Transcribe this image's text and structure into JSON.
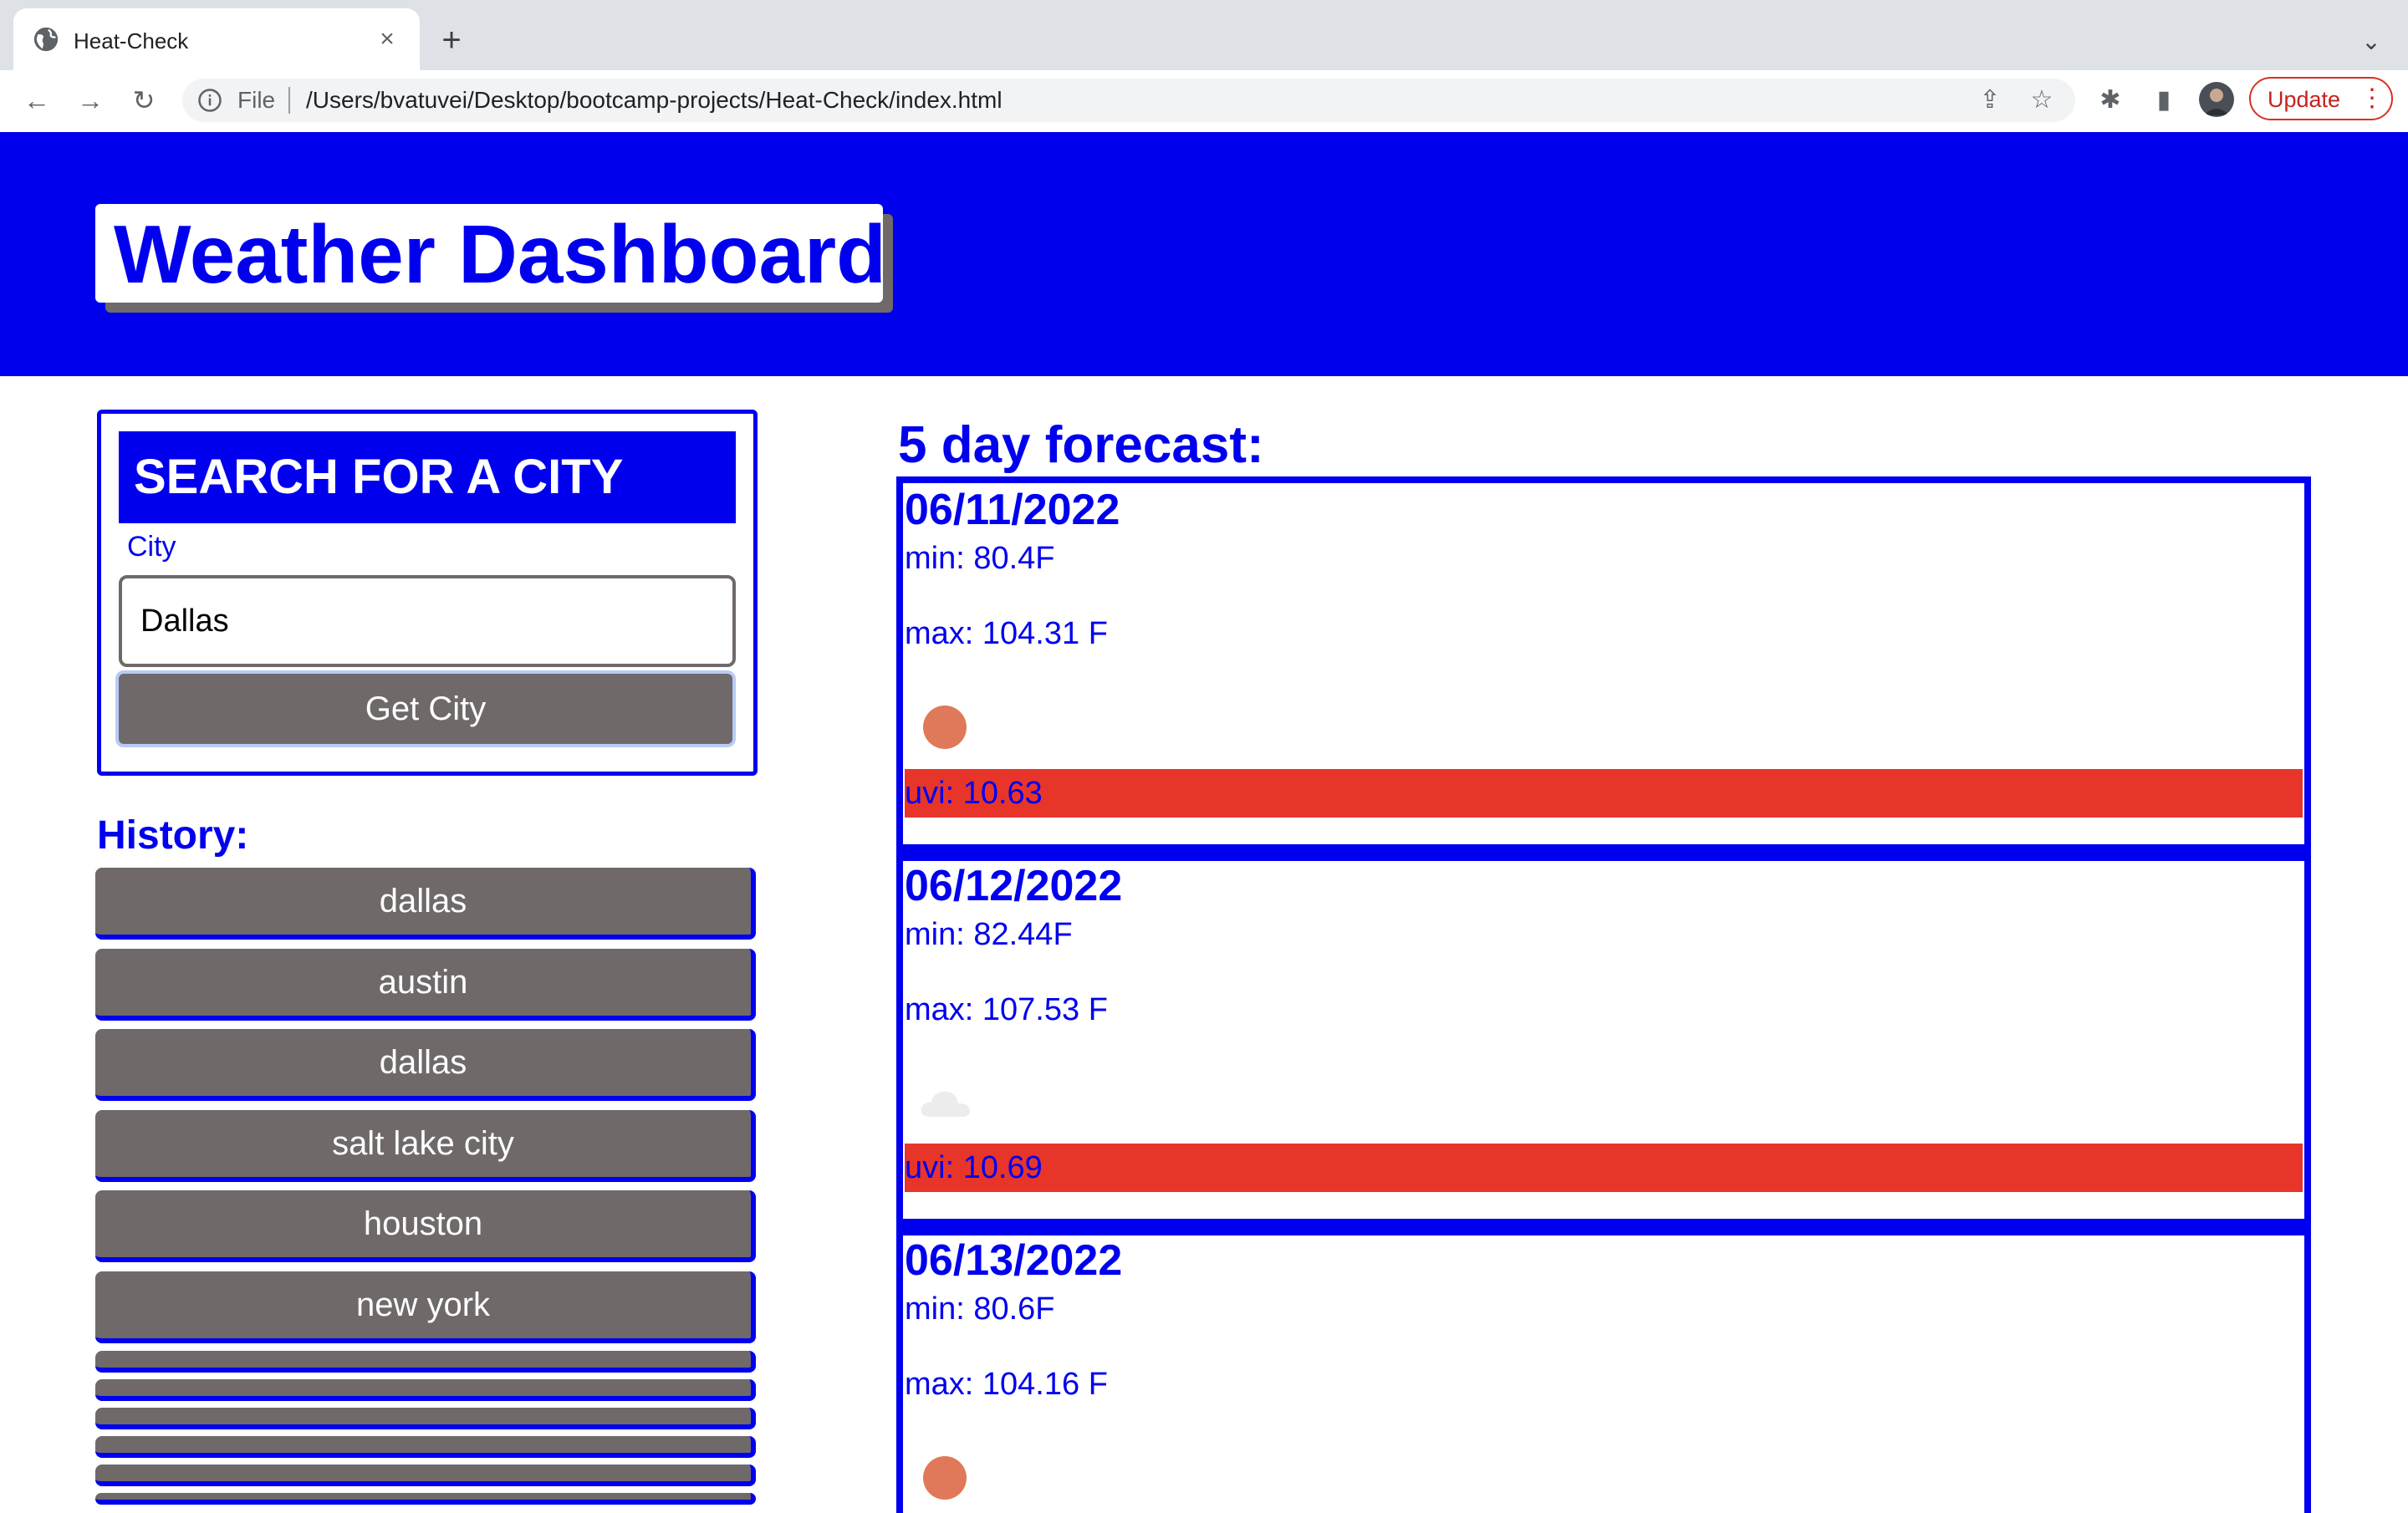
{
  "browser": {
    "tab_title": "Heat-Check",
    "tab_close": "×",
    "new_tab": "+",
    "tab_menu": "⌄",
    "url_prefix": "File",
    "url": "/Users/bvatuvei/Desktop/bootcamp-projects/Heat-Check/index.html",
    "update_label": "Update",
    "update_menu": "⋮",
    "nav": {
      "back": "←",
      "forward": "→",
      "reload": "↻"
    },
    "toolbar_icons": {
      "share": "⇪",
      "bookmark": "☆",
      "extensions": "✱",
      "sidepanel": "▮"
    },
    "update_color": "#d93025"
  },
  "header": {
    "title": "Weather Dashboard",
    "bg_color": "#0000ee"
  },
  "search": {
    "heading": "SEARCH FOR A CITY",
    "city_label": "City",
    "city_value": "Dallas",
    "button_label": "Get City"
  },
  "history": {
    "heading": "History:",
    "items": [
      "dallas",
      "austin",
      "dallas",
      "salt lake city",
      "houston",
      "new york"
    ]
  },
  "forecast": {
    "heading": "5 day forecast:",
    "days": [
      {
        "date": "06/11/2022",
        "min": "min: 80.4F",
        "max": "max: 104.31 F",
        "icon": "sun-icon",
        "uvi": "uvi: 10.63",
        "uvi_color": "#e8352a"
      },
      {
        "date": "06/12/2022",
        "min": "min: 82.44F",
        "max": "max: 107.53 F",
        "icon": "cloud-icon",
        "uvi": "uvi: 10.69",
        "uvi_color": "#e8352a"
      },
      {
        "date": "06/13/2022",
        "min": "min: 80.6F",
        "max": "max: 104.16 F",
        "icon": "sun-icon"
      }
    ]
  },
  "colors": {
    "accent": "#0000ee",
    "button_gray": "#6f6969",
    "uvi_high": "#e8352a"
  }
}
